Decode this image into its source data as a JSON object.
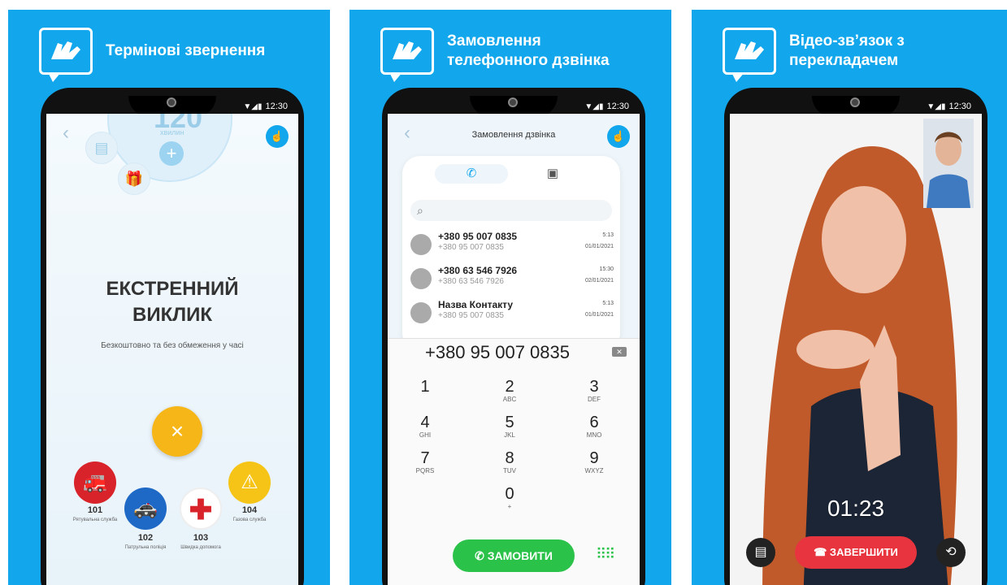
{
  "colors": {
    "brand_blue": "#12a7ec",
    "yellow": "#f6b617",
    "green": "#2bc24a",
    "red": "#e7343e"
  },
  "panel1": {
    "title": "Термінові звернення",
    "status_time": "12:30",
    "minutes_value": "120",
    "minutes_label": "хвилин",
    "emergency_title_line1": "ЕКСТРЕННИЙ",
    "emergency_title_line2": "ВИКЛИК",
    "emergency_subtitle": "Безкоштовно та без обмеження у часі",
    "close_label": "×",
    "services": [
      {
        "number": "101",
        "label": "Рятувальна служба",
        "color": "#d8232a",
        "icon": "fire-truck-icon"
      },
      {
        "number": "102",
        "label": "Патрульна поліція",
        "color": "#1f69c6",
        "icon": "police-car-icon"
      },
      {
        "number": "103",
        "label": "Швидка допомога",
        "color": "#ffffff",
        "icon": "medical-cross-icon"
      },
      {
        "number": "104",
        "label": "Газова служба",
        "color": "#f6c417",
        "icon": "warning-icon"
      }
    ]
  },
  "panel2": {
    "title_line1": "Замовлення",
    "title_line2": "телефонного дзвінка",
    "status_time": "12:30",
    "screen_title": "Замовлення дзвінка",
    "calls": [
      {
        "name": "+380 95 007 0835",
        "number": "+380 95 007 0835",
        "time": "5:13",
        "date": "01/01/2021"
      },
      {
        "name": "+380 63 546 7926",
        "number": "+380 63 546 7926",
        "time": "15:30",
        "date": "02/01/2021"
      },
      {
        "name": "Назва Контакту",
        "number": "+380 95 007 0835",
        "time": "5:13",
        "date": "01/01/2021"
      }
    ],
    "dialed_number": "+380 95 007 0835",
    "keys": [
      {
        "d": "1",
        "l": ""
      },
      {
        "d": "2",
        "l": "ABC"
      },
      {
        "d": "3",
        "l": "DEF"
      },
      {
        "d": "4",
        "l": "GHI"
      },
      {
        "d": "5",
        "l": "JKL"
      },
      {
        "d": "6",
        "l": "MNO"
      },
      {
        "d": "7",
        "l": "PQRS"
      },
      {
        "d": "8",
        "l": "TUV"
      },
      {
        "d": "9",
        "l": "WXYZ"
      },
      {
        "d": "0",
        "l": "+"
      }
    ],
    "order_button": "ЗАМОВИТИ"
  },
  "panel3": {
    "title_line1": "Відео-зв’язок з",
    "title_line2": "перекладачем",
    "status_time": "12:30",
    "call_timer": "01:23",
    "end_button": "ЗАВЕРШИТИ"
  }
}
